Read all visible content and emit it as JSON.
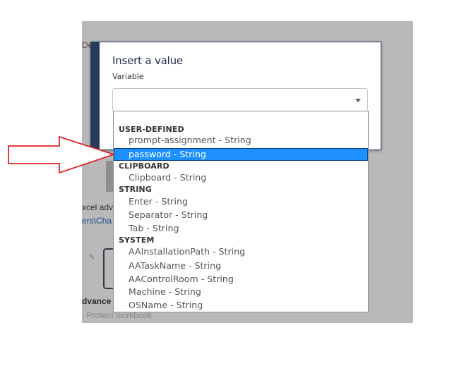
{
  "background": {
    "fragment_top": "De",
    "fragment_excel": "xcel adv",
    "fragment_path": "ers\\Cha",
    "fragment_advance": "dvance",
    "fragment_bottom": ": Protect workbook",
    "checkbox_icon": "edit-icon"
  },
  "dialog": {
    "title": "Insert a value",
    "field_label": "Variable",
    "select_value": ""
  },
  "dropdown": {
    "groups": [
      {
        "header": "USER-DEFINED",
        "options": [
          "prompt-assignment - String",
          "password - String"
        ]
      },
      {
        "header": "CLIPBOARD",
        "options": [
          "Clipboard - String"
        ]
      },
      {
        "header": "STRING",
        "options": [
          "Enter - String",
          "Separator - String",
          "Tab - String"
        ]
      },
      {
        "header": "SYSTEM",
        "options": [
          "AAInstallationPath - String",
          "AATaskName - String",
          "AAControlRoom - String",
          "Machine - String",
          "OSName - String"
        ]
      }
    ],
    "selected_option": "password - String"
  },
  "colors": {
    "selected_bg": "#1e90ff",
    "annotation_arrow": "#e0242b",
    "dialog_accent": "#273c5a"
  }
}
